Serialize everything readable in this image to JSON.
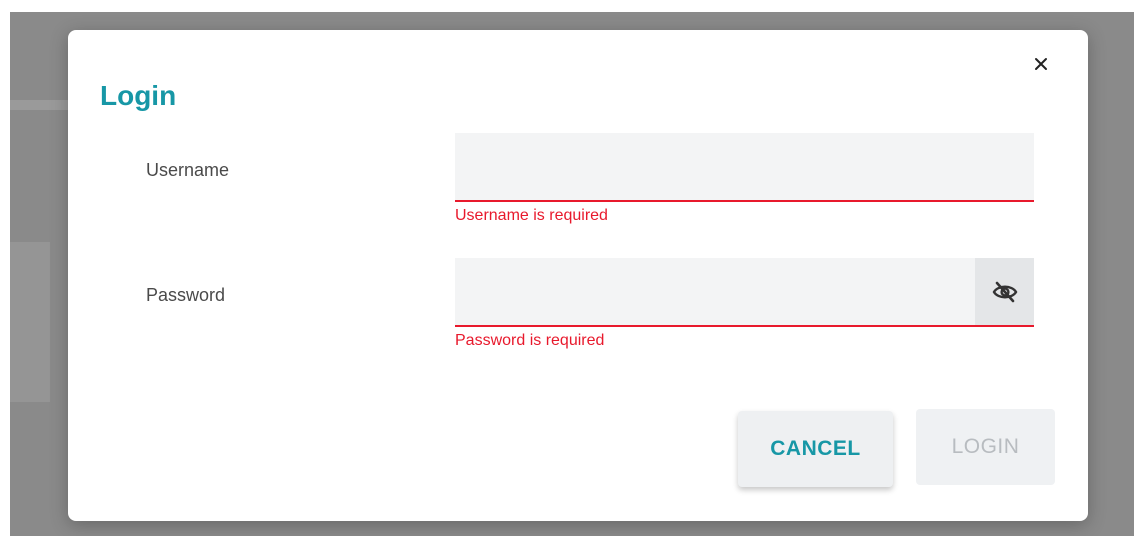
{
  "dialog": {
    "title": "Login",
    "close_glyph": "×"
  },
  "form": {
    "username": {
      "label": "Username",
      "value": "",
      "error": "Username is required"
    },
    "password": {
      "label": "Password",
      "value": "",
      "error": "Password is required",
      "toggle_icon": "eye-slash-icon"
    }
  },
  "actions": {
    "cancel_label": "CANCEL",
    "login_label": "LOGIN"
  },
  "colors": {
    "accent": "#1797a6",
    "error": "#e8192c",
    "overlay": "#8a8a8a"
  }
}
